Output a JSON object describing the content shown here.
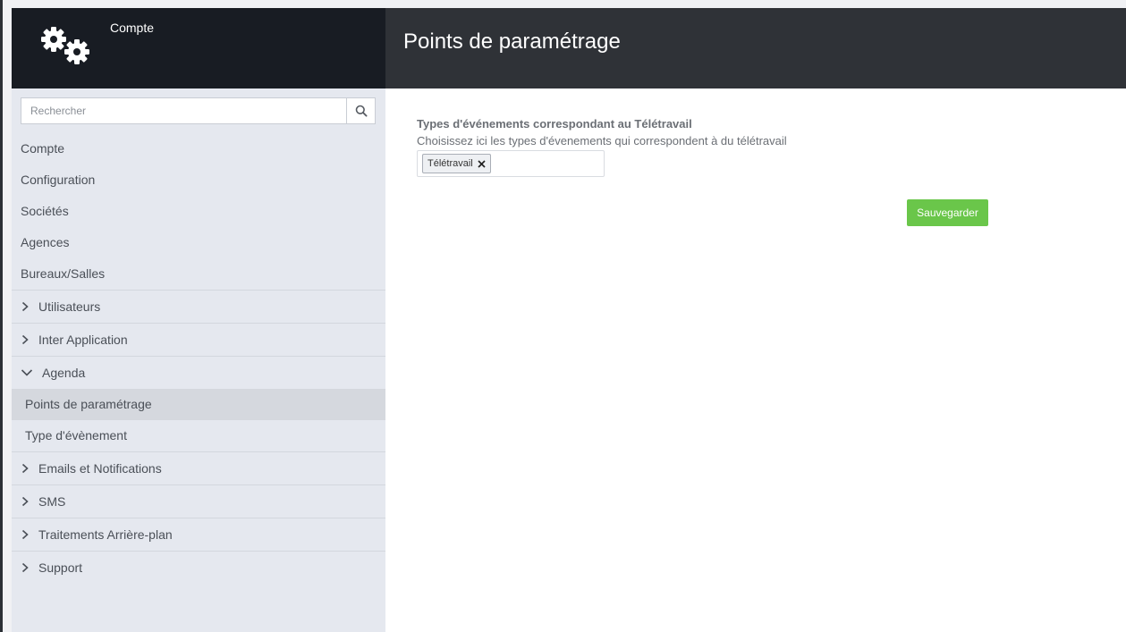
{
  "brand": {
    "title": "Compte",
    "icon": "gears-icon"
  },
  "search": {
    "placeholder": "Rechercher",
    "icon": "search-icon"
  },
  "sidebar": {
    "simple_items": [
      {
        "label": "Compte"
      },
      {
        "label": "Configuration"
      },
      {
        "label": "Sociétés"
      },
      {
        "label": "Agences"
      },
      {
        "label": "Bureaux/Salles"
      }
    ],
    "groups": [
      {
        "label": "Utilisateurs",
        "expanded": false
      },
      {
        "label": "Inter Application",
        "expanded": false
      },
      {
        "label": "Agenda",
        "expanded": true,
        "children": [
          {
            "label": "Points de paramétrage",
            "active": true
          },
          {
            "label": "Type d'évènement",
            "active": false
          }
        ]
      },
      {
        "label": "Emails et Notifications",
        "expanded": false
      },
      {
        "label": "SMS",
        "expanded": false
      },
      {
        "label": "Traitements Arrière-plan",
        "expanded": false
      },
      {
        "label": "Support",
        "expanded": false
      }
    ]
  },
  "main": {
    "title": "Points de paramétrage",
    "field": {
      "label": "Types d'événements correspondant au Télétravail",
      "help": "Choisissez ici les types d'évenements qui correspondent à du télétravail",
      "tags": [
        "Télétravail"
      ]
    },
    "save_label": "Sauvegarder"
  },
  "colors": {
    "brand_bg": "#181c23",
    "topbar_bg": "#2f3237",
    "sidebar_bg": "#e5e8ef",
    "active_item_bg": "#d5d8de",
    "save_button": "#6ac64a"
  }
}
